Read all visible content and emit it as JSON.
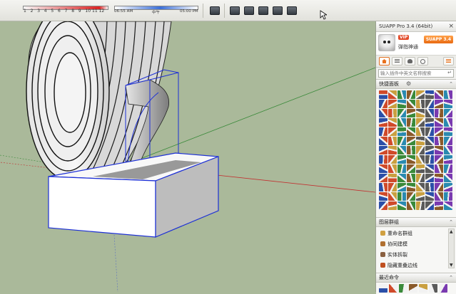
{
  "toolbar": {
    "shadow_month_ticks": [
      "1",
      "2",
      "3",
      "4",
      "5",
      "6",
      "7",
      "8",
      "9",
      "10",
      "11",
      "12"
    ],
    "time_start": "06:55 AM",
    "time_mid": "中午",
    "time_end": "05:00 PM",
    "icons": [
      "camera-icon",
      "standard-views-icon",
      "iso-view-icon",
      "front-view-icon",
      "side-view-icon",
      "top-view-icon"
    ]
  },
  "panel": {
    "title": "SUAPP Pro 3.4 (64bit)",
    "close_glyph": "×",
    "user_badge": "VIP",
    "username": "弹指神通",
    "version_badge": "SUAPP 3.4",
    "search_placeholder": "输入插件中英文名称搜索",
    "quick_panel_label": "快捷面板",
    "layer_group_label": "图层群组",
    "layer_items": [
      "重命名群组",
      "协同建模",
      "实体拆裂",
      "隐藏重叠边线"
    ],
    "recent_label": "最近命令",
    "colors": {
      "accent": "#e9701a",
      "viewport": "#aab99a",
      "selection": "#1c2fd6"
    }
  }
}
